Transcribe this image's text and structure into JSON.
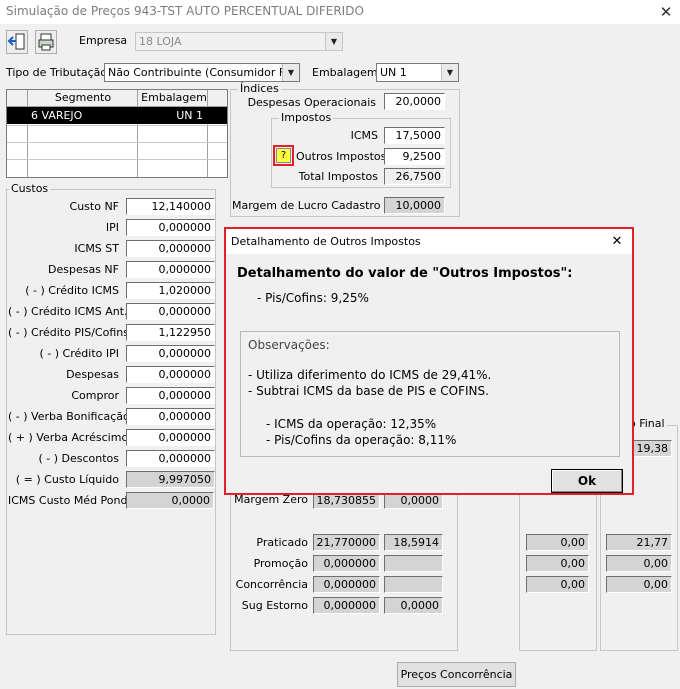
{
  "window": {
    "title": "Simulação de Preços  943-TST AUTO PERCENTUAL DIFERIDO",
    "close_glyph": "✕"
  },
  "toolbar": {
    "exit_glyph": "⇥",
    "print_glyph": "⎙"
  },
  "header": {
    "empresa_label": "Empresa",
    "empresa_value": "18 LOJA",
    "tributacao_label": "Tipo de Tributação",
    "tributacao_value": "Não Contribuinte (Consumidor Final)",
    "embalagem_label": "Embalagem",
    "embalagem_value": "UN  1"
  },
  "segment_grid": {
    "headers": [
      "Segmento",
      "Embalagem"
    ],
    "rows": [
      {
        "segmento": "6 VAREJO",
        "embalagem": "UN  1"
      }
    ]
  },
  "indices": {
    "group_label": "Índices",
    "despesas_label": "Despesas Operacionais",
    "despesas_value": "20,0000",
    "impostos_group_label": "Impostos",
    "icms_label": "ICMS",
    "icms_value": "17,5000",
    "help_glyph": "?",
    "outros_label": "Outros Impostos",
    "outros_value": "9,2500",
    "total_label": "Total Impostos",
    "total_value": "26,7500",
    "margem_label": "Margem de Lucro Cadastro",
    "margem_value": "10,0000",
    "margem_zero_label": "Margem Zero",
    "margem_zero_values": [
      "18,730855",
      "0,0000"
    ]
  },
  "custos": {
    "group_label": "Custos",
    "rows": [
      {
        "label": "Custo NF",
        "value": "12,140000"
      },
      {
        "label": "IPI",
        "value": "0,000000"
      },
      {
        "label": "ICMS ST",
        "value": "0,000000"
      },
      {
        "label": "Despesas NF",
        "value": "0,000000"
      },
      {
        "label": "( - ) Crédito ICMS",
        "value": "1,020000"
      },
      {
        "label": "( - ) Crédito ICMS Ant.",
        "value": "0,000000"
      },
      {
        "label": "( - ) Crédito PIS/Cofins",
        "value": "1,122950"
      },
      {
        "label": "( - ) Crédito IPI",
        "value": "0,000000"
      },
      {
        "label": "Despesas",
        "value": "0,000000"
      },
      {
        "label": "Compror",
        "value": "0,000000"
      },
      {
        "label": "( - ) Verba Bonificação",
        "value": "0,000000"
      },
      {
        "label": "( + ) Verba Acréscimo",
        "value": "0,000000"
      },
      {
        "label": "( - ) Descontos",
        "value": "0,000000"
      },
      {
        "label": "( = ) Custo Líquido",
        "value": "9,997050"
      },
      {
        "label": "ICMS Custo Méd Pond.",
        "value": "0,0000"
      }
    ]
  },
  "precos": {
    "praticado_label": "Praticado",
    "praticado_values": [
      "21,770000",
      "18,5914"
    ],
    "promocao_label": "Promoção",
    "promocao_value": "0,000000",
    "concorrencia_label": "Concorrência",
    "concorrencia_value": "0,000000",
    "sug_estorno_label": "Sug Estorno",
    "sug_estorno_values": [
      "0,000000",
      "0,0000"
    ]
  },
  "right_panel": {
    "preco_final_label": "o Final",
    "col1_values": [
      "0,00",
      "0,00",
      "0,00"
    ],
    "col2_top_value": "19,38",
    "col2_values": [
      "21,77",
      "0,00",
      "0,00"
    ]
  },
  "precos_concorrencia_button": "Preços Concorrência",
  "dialog": {
    "title": "Detalhamento de Outros Impostos",
    "close_glyph": "✕",
    "heading": "Detalhamento do valor de \"Outros Impostos\":",
    "pis_line": "- Pis/Cofins: 9,25%",
    "obs_label": "Observações:",
    "obs_lines": [
      "- Utiliza diferimento do ICMS de 29,41%.",
      "- Subtrai ICMS da base de PIS  e COFINS."
    ],
    "op_lines": [
      "- ICMS da operação: 12,35%",
      "- Pis/Cofins da operação: 8,11%"
    ],
    "ok_label": "Ok"
  },
  "colors": {
    "dialog_border": "#e0202a",
    "selection": "#000000",
    "help_bg": "#ffff40"
  }
}
